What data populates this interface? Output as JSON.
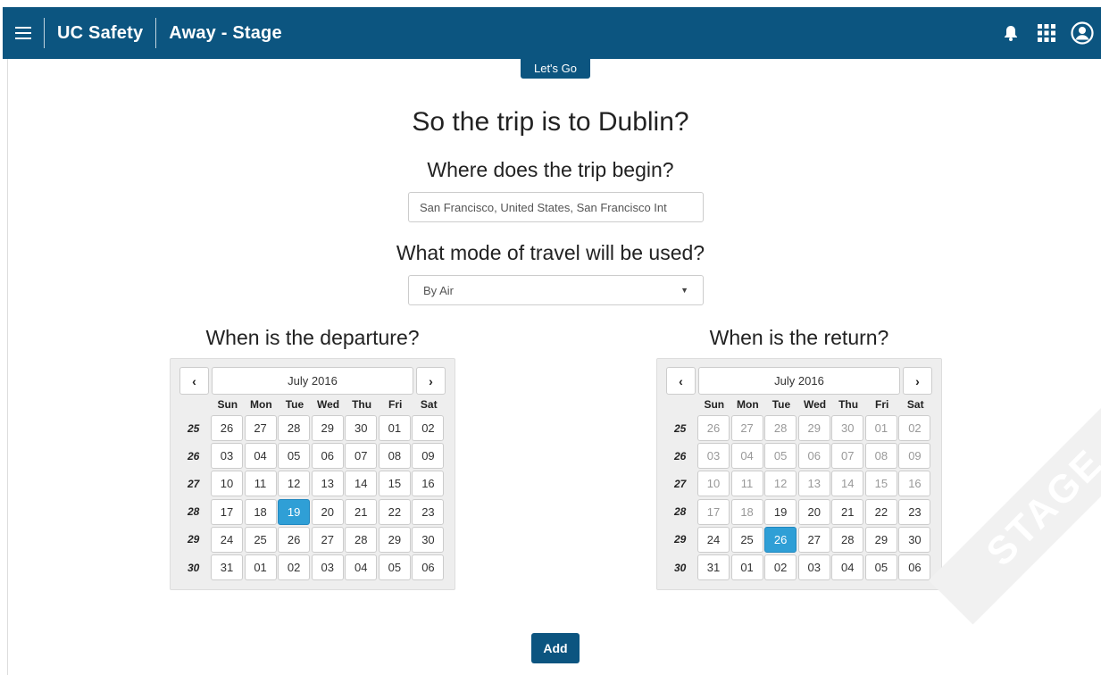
{
  "header": {
    "brand": "UC Safety",
    "environment": "Away - Stage",
    "icons": [
      "menu-icon",
      "bell-icon",
      "apps-grid-icon",
      "user-circle-icon"
    ],
    "background": "#0c5580"
  },
  "lets_go_label": "Let's Go",
  "title": "So the trip is to Dublin?",
  "origin": {
    "question": "Where does the trip begin?",
    "value": "San Francisco, United States,  San Francisco Int"
  },
  "mode": {
    "question": "What mode of travel will be used?",
    "selected": "By Air"
  },
  "departure": {
    "question": "When is the departure?",
    "month_label": "July 2016",
    "prev": "‹",
    "next": "›",
    "dow": [
      "Sun",
      "Mon",
      "Tue",
      "Wed",
      "Thu",
      "Fri",
      "Sat"
    ],
    "weeks": [
      {
        "num": "25",
        "days": [
          "26",
          "27",
          "28",
          "29",
          "30",
          "01",
          "02"
        ]
      },
      {
        "num": "26",
        "days": [
          "03",
          "04",
          "05",
          "06",
          "07",
          "08",
          "09"
        ]
      },
      {
        "num": "27",
        "days": [
          "10",
          "11",
          "12",
          "13",
          "14",
          "15",
          "16"
        ]
      },
      {
        "num": "28",
        "days": [
          "17",
          "18",
          "19",
          "20",
          "21",
          "22",
          "23"
        ]
      },
      {
        "num": "29",
        "days": [
          "24",
          "25",
          "26",
          "27",
          "28",
          "29",
          "30"
        ]
      },
      {
        "num": "30",
        "days": [
          "31",
          "01",
          "02",
          "03",
          "04",
          "05",
          "06"
        ]
      }
    ],
    "selected_day": "19"
  },
  "return": {
    "question": "When is the return?",
    "month_label": "July 2016",
    "prev": "‹",
    "next": "›",
    "dow": [
      "Sun",
      "Mon",
      "Tue",
      "Wed",
      "Thu",
      "Fri",
      "Sat"
    ],
    "weeks": [
      {
        "num": "25",
        "days": [
          "26",
          "27",
          "28",
          "29",
          "30",
          "01",
          "02"
        ]
      },
      {
        "num": "26",
        "days": [
          "03",
          "04",
          "05",
          "06",
          "07",
          "08",
          "09"
        ]
      },
      {
        "num": "27",
        "days": [
          "10",
          "11",
          "12",
          "13",
          "14",
          "15",
          "16"
        ]
      },
      {
        "num": "28",
        "days": [
          "17",
          "18",
          "19",
          "20",
          "21",
          "22",
          "23"
        ]
      },
      {
        "num": "29",
        "days": [
          "24",
          "25",
          "26",
          "27",
          "28",
          "29",
          "30"
        ]
      },
      {
        "num": "30",
        "days": [
          "31",
          "01",
          "02",
          "03",
          "04",
          "05",
          "06"
        ]
      }
    ],
    "selected_day": "26",
    "disabled_before_day": "19"
  },
  "add_label": "Add",
  "watermark": "STAGE",
  "accent": "#2f9fd6"
}
